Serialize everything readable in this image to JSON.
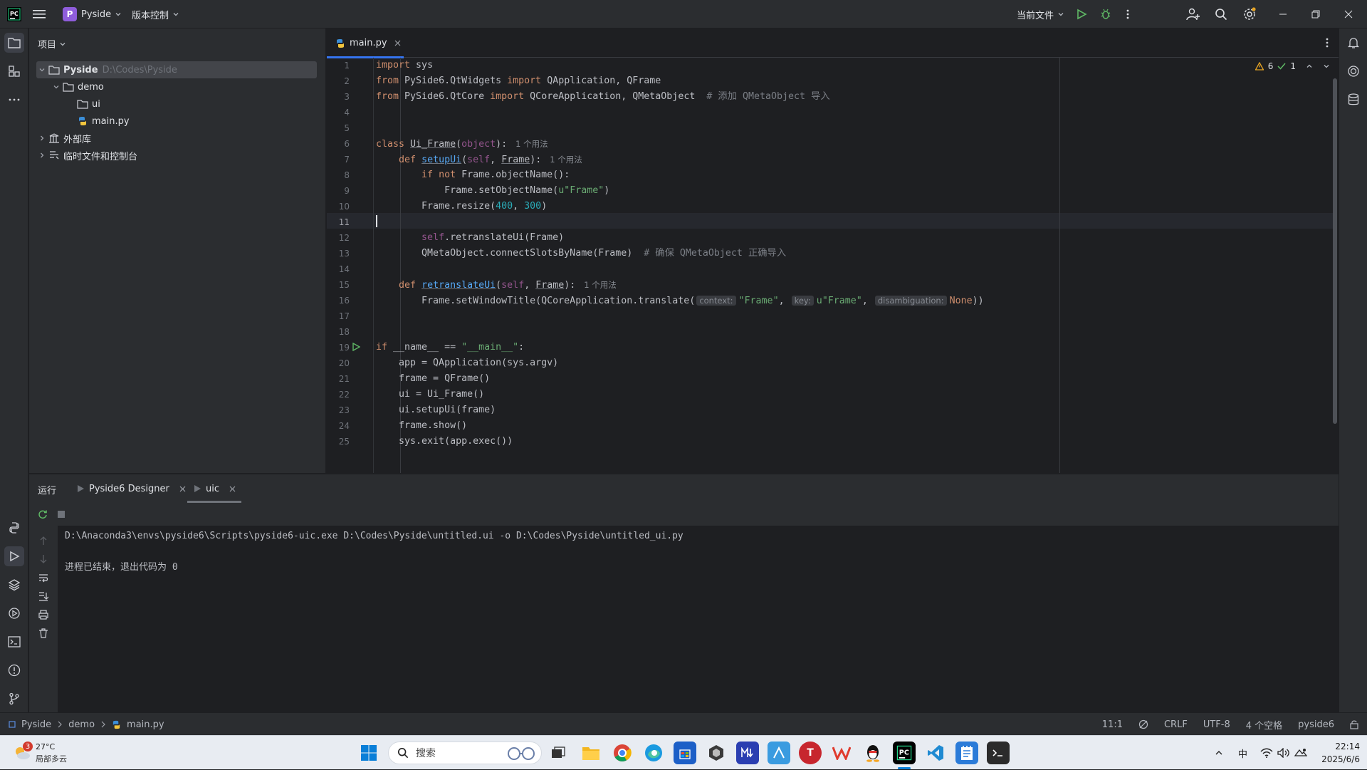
{
  "titlebar": {
    "project_badge": "P",
    "project_name": "Pyside",
    "vcs_label": "版本控制",
    "run_config": "当前文件"
  },
  "project_panel": {
    "title": "项目",
    "tree": [
      {
        "label": "Pyside",
        "path": "D:\\Codes\\Pyside"
      },
      {
        "label": "demo"
      },
      {
        "label": "ui"
      },
      {
        "label": "main.py"
      },
      {
        "label": "外部库"
      },
      {
        "label": "临时文件和控制台"
      }
    ]
  },
  "editor": {
    "tab_label": "main.py",
    "warnings": "6",
    "checks": "1",
    "line_numbers": [
      "1",
      "2",
      "3",
      "4",
      "5",
      "6",
      "7",
      "8",
      "9",
      "10",
      "11",
      "12",
      "13",
      "14",
      "15",
      "16",
      "17",
      "18",
      "19",
      "20",
      "21",
      "22",
      "23",
      "24",
      "25"
    ],
    "hints": {
      "usage": "1 个用法"
    },
    "inlays": {
      "context": "context:",
      "key": "key:",
      "disambiguation": "disambiguation:"
    },
    "code": {
      "l1": [
        "import",
        " sys"
      ],
      "l2": [
        "from",
        " PySide6.QtWidgets ",
        "import",
        " QApplication, QFrame"
      ],
      "l3": [
        "from",
        " PySide6.QtCore ",
        "import",
        " QCoreApplication, QMetaObject  ",
        "# 添加 QMetaObject 导入"
      ],
      "l6": [
        "class",
        " ",
        "Ui_Frame",
        "(",
        "object",
        "):"
      ],
      "l7": [
        "    ",
        "def",
        " ",
        "setupUi",
        "(",
        "self",
        ", ",
        "Frame",
        "):"
      ],
      "l8": [
        "        ",
        "if not",
        " Frame.objectName():"
      ],
      "l9": [
        "            Frame.setObjectName(",
        "u\"Frame\"",
        ")"
      ],
      "l10": [
        "        Frame.resize(",
        "400",
        ", ",
        "300",
        ")"
      ],
      "l12": [
        "        ",
        "self",
        ".retranslateUi(Frame)"
      ],
      "l13": [
        "        QMetaObject.connectSlotsByName(Frame)  ",
        "# 确保 QMetaObject 正确导入"
      ],
      "l15": [
        "    ",
        "def",
        " ",
        "retranslateUi",
        "(",
        "self",
        ", ",
        "Frame",
        "):"
      ],
      "l16": [
        "        Frame.setWindowTitle(QCoreApplication.translate(",
        "\"Frame\"",
        ", ",
        "u\"Frame\"",
        ", ",
        "None",
        "))"
      ],
      "l19": [
        "if",
        " __name__ == ",
        "\"__main__\"",
        ":"
      ],
      "l20": [
        "    app = QApplication(sys.argv)"
      ],
      "l21": [
        "    frame = QFrame()"
      ],
      "l22": [
        "    ui = Ui_Frame()"
      ],
      "l23": [
        "    ui.setupUi(frame)"
      ],
      "l24": [
        "    frame.show()"
      ],
      "l25": [
        "    sys.exit(app.exec())"
      ]
    }
  },
  "run_panel": {
    "title": "运行",
    "tabs": [
      {
        "label": "Pyside6 Designer"
      },
      {
        "label": "uic"
      }
    ],
    "output": [
      "D:\\Anaconda3\\envs\\pyside6\\Scripts\\pyside6-uic.exe D:\\Codes\\Pyside\\untitled.ui -o D:\\Codes\\Pyside\\untitled_ui.py",
      "",
      "进程已结束，退出代码为 0"
    ]
  },
  "statusbar": {
    "crumbs": [
      "Pyside",
      "demo",
      "main.py"
    ],
    "position": "11:1",
    "line_sep": "CRLF",
    "encoding": "UTF-8",
    "indent": "4 个空格",
    "interpreter": "pyside6"
  },
  "taskbar": {
    "weather_badge": "3",
    "weather_temp": "27°C",
    "weather_desc": "局部多云",
    "search_label": "搜索",
    "ime": "中",
    "time": "22:14",
    "date": "2025/6/6"
  },
  "colors": {
    "accent": "#3574f0",
    "keyword": "#cf8e6d",
    "function": "#56a8f5",
    "string": "#6aab73",
    "number": "#2aacb8"
  }
}
